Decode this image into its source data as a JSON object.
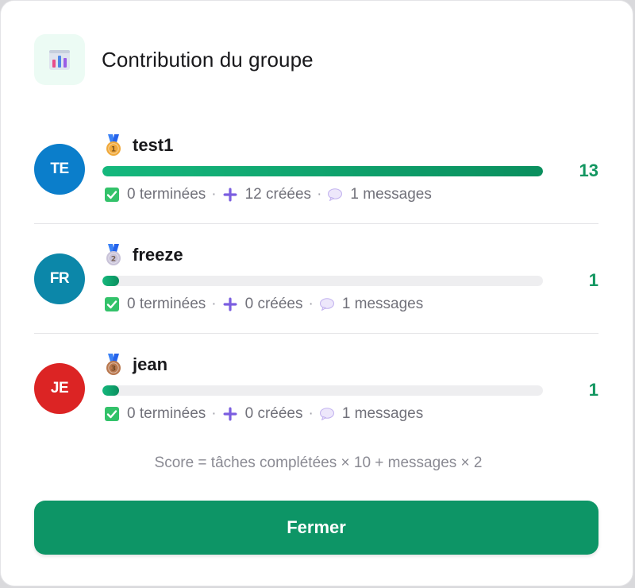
{
  "header": {
    "icon": "bar-chart-icon",
    "title": "Contribution du groupe"
  },
  "members": [
    {
      "initials": "TE",
      "avatar_color": "#0b7ecb",
      "medal": "gold-medal-icon",
      "medal_rank": "1",
      "medal_color": "#f0a93b",
      "name": "test1",
      "progress": 1.0,
      "score": "13",
      "completed": "0 terminées",
      "created": "12 créées",
      "messages": "1 messages"
    },
    {
      "initials": "FR",
      "avatar_color": "#0c87a9",
      "medal": "silver-medal-icon",
      "medal_rank": "2",
      "medal_color": "#c9c3d9",
      "name": "freeze",
      "progress": 0.0385,
      "score": "1",
      "completed": "0 terminées",
      "created": "0 créées",
      "messages": "1 messages"
    },
    {
      "initials": "JE",
      "avatar_color": "#dc2424",
      "medal": "bronze-medal-icon",
      "medal_rank": "3",
      "medal_color": "#b9784f",
      "name": "jean",
      "progress": 0.0385,
      "score": "1",
      "completed": "0 terminées",
      "created": "0 créées",
      "messages": "1 messages"
    }
  ],
  "separator": "·",
  "formula": "Score = tâches complétées × 10 + messages × 2",
  "close_label": "Fermer",
  "colors": {
    "accent": "#0d9566",
    "score": "#129660"
  }
}
